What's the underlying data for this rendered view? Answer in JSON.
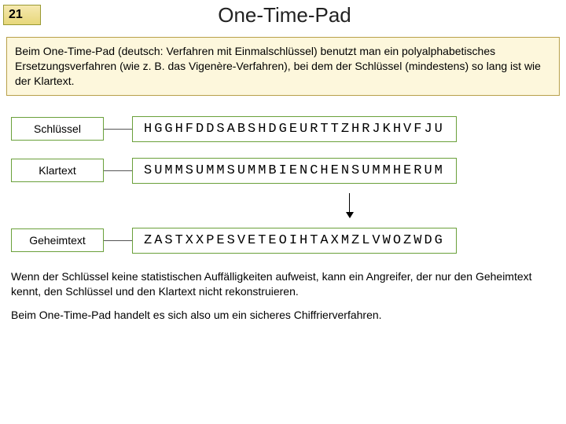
{
  "header": {
    "slide_number": "21",
    "title": "One-Time-Pad"
  },
  "intro": "Beim One-Time-Pad (deutsch: Verfahren mit Einmalschlüssel) benutzt man ein polyalphabetisches Ersetzungsverfahren (wie z. B. das Vigenère-Verfahren), bei dem der Schlüssel (mindestens) so lang ist wie der Klartext.",
  "rows": {
    "key": {
      "label": "Schlüssel",
      "value": "HGGHFDDSABSHDGEURTTZHRJKHVFJU"
    },
    "plain": {
      "label": "Klartext",
      "value": "SUMMSUMMSUMMBIENCHENSUMMHERUM"
    },
    "cipher": {
      "label": "Geheimtext",
      "value": "ZASTXXPESVETEOIHTAXMZLVWOZWDG"
    }
  },
  "p1": "Wenn der Schlüssel keine statistischen Auffälligkeiten aufweist, kann ein Angreifer, der nur den Geheimtext kennt, den Schlüssel und den Klartext nicht rekonstruieren.",
  "p2": "Beim One-Time-Pad handelt es sich also um ein sicheres Chiffrierverfahren."
}
